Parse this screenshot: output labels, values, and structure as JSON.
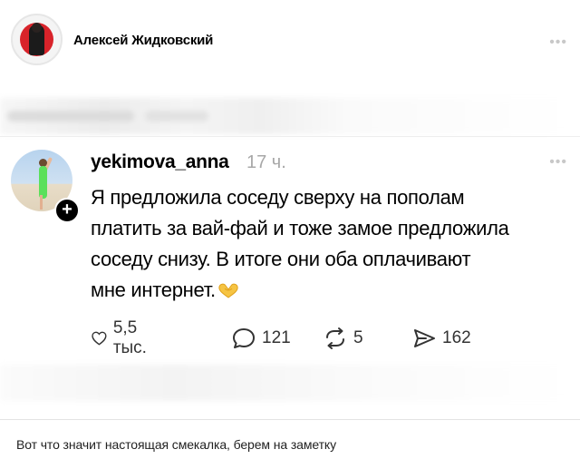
{
  "header": {
    "author_name": "Алексей Жидковский",
    "more_icon": "more-dots-icon"
  },
  "post": {
    "username": "yekimova_anna",
    "time_ago": "17 ч.",
    "text_lines": [
      "Я предложила соседу сверху на пополам",
      "платить за вай-фай и тоже замое предложила",
      "соседу снизу. В итоге они оба оплачивают",
      "мне интернет."
    ],
    "emoji": "heart-hands-icon",
    "follow_badge": "+",
    "actions": {
      "likes": "5,5 тыс.",
      "comments": "121",
      "reposts": "5",
      "shares": "162"
    }
  },
  "caption": "Вот что значит настоящая смекалка, берем на заметку",
  "colors": {
    "accent_red": "#d8232a",
    "muted_text": "#a8a8a8",
    "icon_gray": "#333333"
  }
}
